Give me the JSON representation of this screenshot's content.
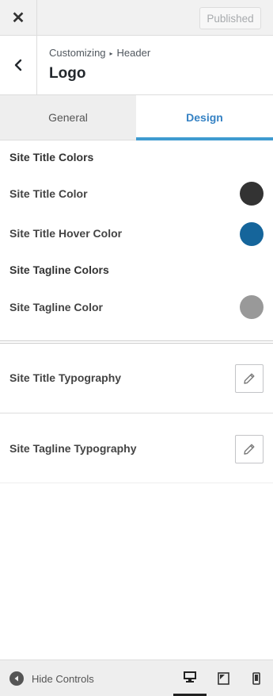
{
  "topbar": {
    "close_glyph": "✕",
    "publish_label": "Published"
  },
  "header": {
    "breadcrumb_root": "Customizing",
    "breadcrumb_sep": "▸",
    "breadcrumb_section": "Header",
    "title": "Logo"
  },
  "tabs": [
    {
      "label": "General",
      "active": false
    },
    {
      "label": "Design",
      "active": true
    }
  ],
  "site_title_colors": {
    "heading": "Site Title Colors",
    "color_label": "Site Title Color",
    "color_value": "#333333",
    "hover_label": "Site Title Hover Color",
    "hover_value": "#15659b"
  },
  "site_tagline_colors": {
    "heading": "Site Tagline Colors",
    "color_label": "Site Tagline Color",
    "color_value": "#999999"
  },
  "typography": [
    {
      "label": "Site Title Typography",
      "icon": "pencil-icon"
    },
    {
      "label": "Site Tagline Typography",
      "icon": "pencil-icon"
    }
  ],
  "footer": {
    "hide_controls_label": "Hide Controls",
    "devices": [
      {
        "name": "desktop-icon",
        "active": true
      },
      {
        "name": "tablet-icon",
        "active": false
      },
      {
        "name": "mobile-icon",
        "active": false
      }
    ]
  }
}
